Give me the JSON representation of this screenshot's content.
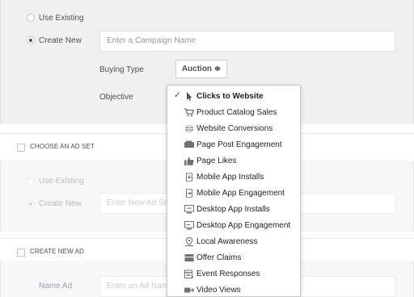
{
  "campaign": {
    "use_existing": "Use Existing",
    "create_new": "Create New",
    "name_placeholder": "Enter a Campaign Name",
    "buying_type_label": "Buying Type",
    "buying_type_value": "Auction ≑",
    "objective_label": "Objective"
  },
  "objective_menu": {
    "selected_mark": "✓",
    "items": [
      {
        "label": "Clicks to Website",
        "icon": "cursor-icon"
      },
      {
        "label": "Product Catalog Sales",
        "icon": "cart-icon"
      },
      {
        "label": "Website Conversions",
        "icon": "globe-icon"
      },
      {
        "label": "Page Post Engagement",
        "icon": "post-icon"
      },
      {
        "label": "Page Likes",
        "icon": "thumbs-up-icon"
      },
      {
        "label": "Mobile App Installs",
        "icon": "mobile-install-icon"
      },
      {
        "label": "Mobile App Engagement",
        "icon": "mobile-engage-icon"
      },
      {
        "label": "Desktop App Installs",
        "icon": "desktop-install-icon"
      },
      {
        "label": "Desktop App Engagement",
        "icon": "desktop-engage-icon"
      },
      {
        "label": "Local Awareness",
        "icon": "location-pin-icon"
      },
      {
        "label": "Offer Claims",
        "icon": "offer-icon"
      },
      {
        "label": "Event Responses",
        "icon": "calendar-icon"
      },
      {
        "label": "Video Views",
        "icon": "video-camera-icon"
      }
    ]
  },
  "adset": {
    "header": "CHOOSE AN AD SET",
    "use_existing": "Use Existing",
    "create_new": "Create New",
    "name_placeholder": "Enter New Ad Set Name"
  },
  "ad": {
    "header": "CREATE NEW AD",
    "name_label": "Name Ad",
    "name_placeholder": "Enter an Ad Name"
  },
  "colors": {
    "panel_bg": "#f0f0f1",
    "text": "#4b4f56",
    "icon": "#6d7278"
  }
}
